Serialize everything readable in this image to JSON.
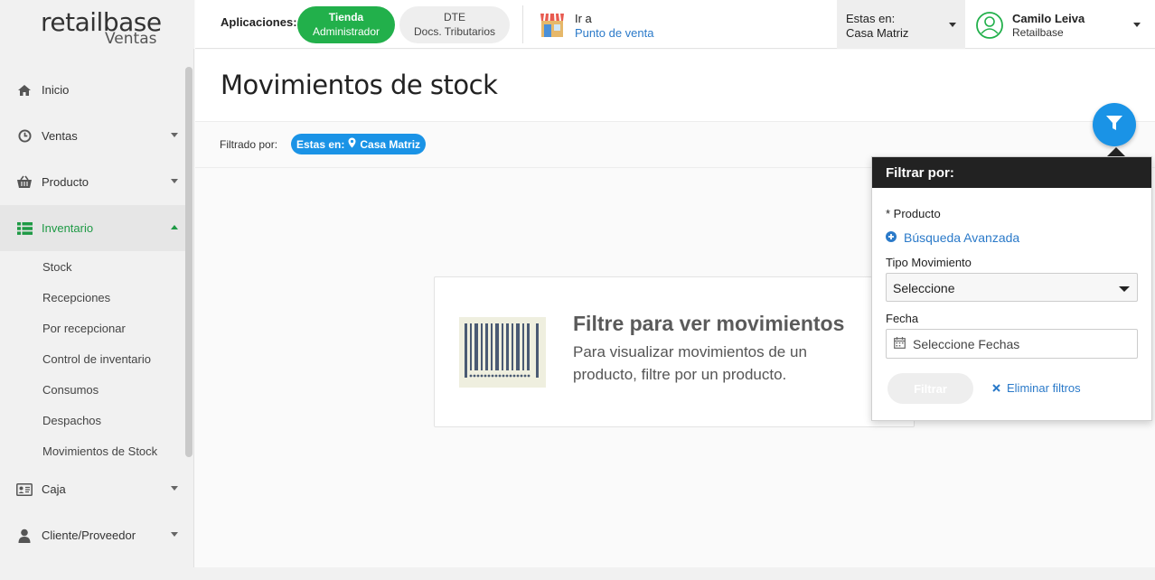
{
  "brand": {
    "name": "retailbase",
    "sub": "Ventas"
  },
  "topbar": {
    "apps_label": "Aplicaciones:",
    "apps": [
      {
        "line1": "Tienda",
        "line2": "Administrador"
      },
      {
        "line1": "DTE",
        "line2": "Docs. Tributarios"
      }
    ],
    "goto_line1": "Ir a",
    "goto_line2": "Punto de venta",
    "location_line1": "Estas en:",
    "location_line2": "Casa Matriz",
    "user_name": "Camilo Leiva",
    "user_company": "Retailbase"
  },
  "sidebar": {
    "items": [
      {
        "label": "Inicio",
        "icon": "home-icon"
      },
      {
        "label": "Ventas",
        "icon": "clock-icon"
      },
      {
        "label": "Producto",
        "icon": "basket-icon"
      },
      {
        "label": "Inventario",
        "icon": "list-icon"
      },
      {
        "label": "Caja",
        "icon": "id-card-icon"
      },
      {
        "label": "Cliente/Proveedor",
        "icon": "user-icon"
      }
    ],
    "inventario_sub": [
      "Stock",
      "Recepciones",
      "Por recepcionar",
      "Control de inventario",
      "Consumos",
      "Despachos",
      "Movimientos de Stock"
    ]
  },
  "main": {
    "title": "Movimientos de stock",
    "filtered_label": "Filtrado por:",
    "chip_prefix": "Estas en:",
    "chip_value": "Casa Matriz",
    "empty_title": "Filtre para ver movimientos",
    "empty_desc": "Para visualizar movimientos de un producto, filtre por un producto."
  },
  "filter_panel": {
    "title": "Filtrar por:",
    "product_label": "* Producto",
    "advanced_search": "Búsqueda Avanzada",
    "movement_label": "Tipo Movimiento",
    "movement_value": "Seleccione",
    "date_label": "Fecha",
    "date_placeholder": "Seleccione Fechas",
    "filter_button": "Filtrar",
    "clear_filters": "Eliminar filtros"
  },
  "colors": {
    "green": "#22b04b",
    "blue": "#1a93e6",
    "link": "#2b7ac9"
  }
}
